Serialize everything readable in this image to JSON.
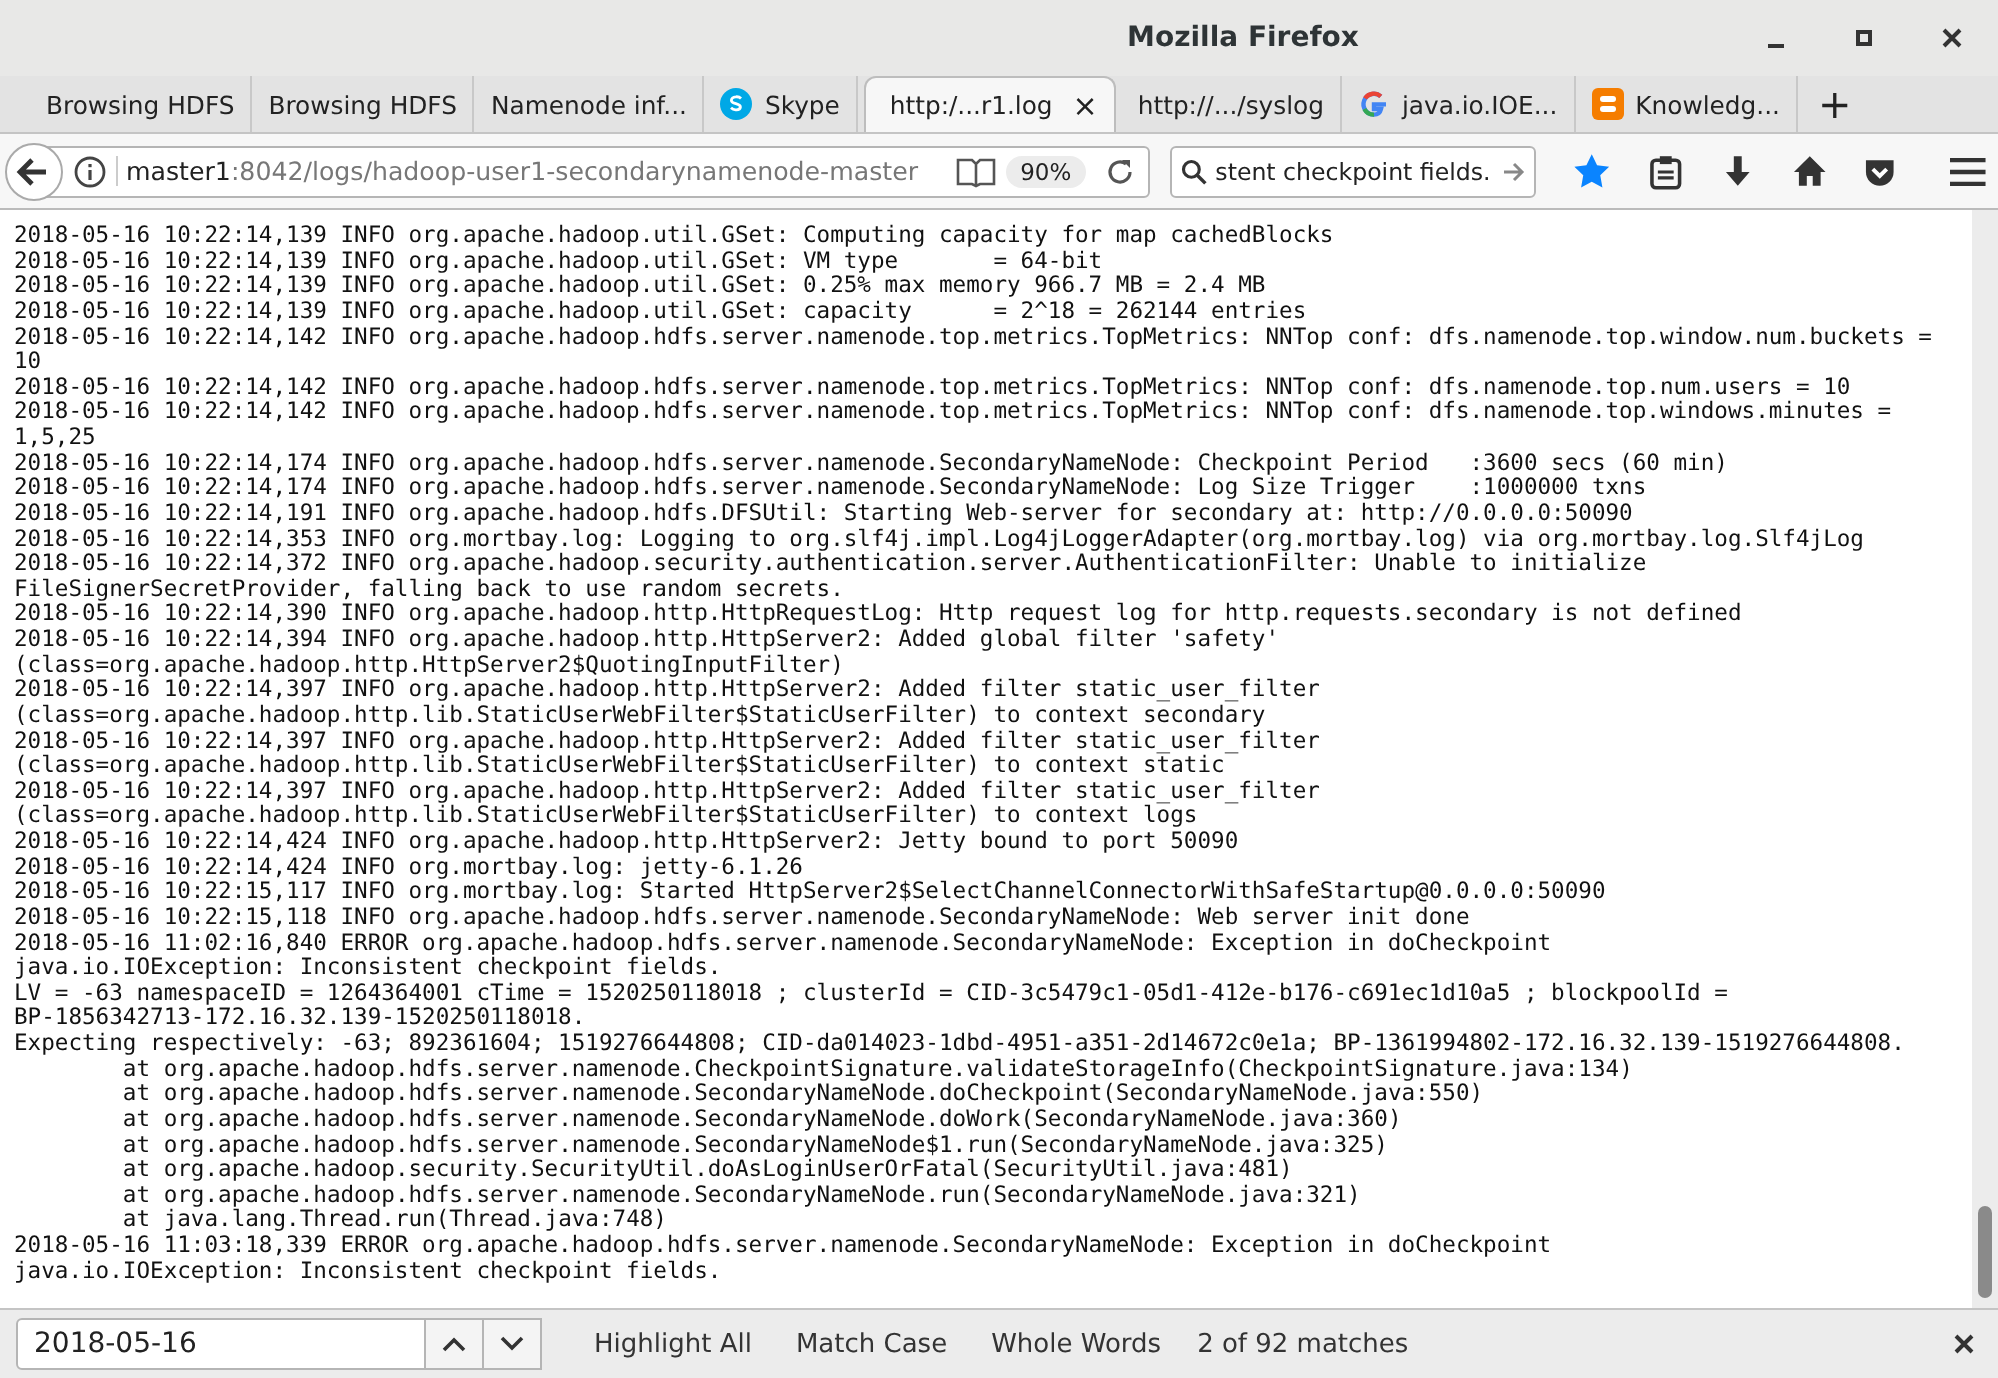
{
  "window": {
    "title": "Mozilla Firefox"
  },
  "tabs": [
    {
      "label": "Browsing HDFS",
      "kind": "plain",
      "selected": false
    },
    {
      "label": "Browsing HDFS",
      "kind": "plain",
      "selected": false
    },
    {
      "label": "Namenode inf...",
      "kind": "plain",
      "selected": false
    },
    {
      "label": "Skype",
      "kind": "skype",
      "selected": false
    },
    {
      "label": "http:/...r1.log",
      "kind": "plain",
      "selected": true,
      "close": "×"
    },
    {
      "label": "http://.../syslog",
      "kind": "plain",
      "selected": false
    },
    {
      "label": "java.io.IOE...",
      "kind": "google",
      "selected": false
    },
    {
      "label": "Knowledg...",
      "kind": "blogger",
      "selected": false
    }
  ],
  "new_tab": "+",
  "address_bar": {
    "host": "master1",
    "path": ":8042/logs/hadoop-user1-secondarynamenode-master",
    "zoom": "90%"
  },
  "search": {
    "value": "stent checkpoint fields."
  },
  "toolbar": {
    "bookmarked": true
  },
  "log_lines": [
    "2018-05-16 10:22:14,139 INFO org.apache.hadoop.util.GSet: Computing capacity for map cachedBlocks",
    "2018-05-16 10:22:14,139 INFO org.apache.hadoop.util.GSet: VM type       = 64-bit",
    "2018-05-16 10:22:14,139 INFO org.apache.hadoop.util.GSet: 0.25% max memory 966.7 MB = 2.4 MB",
    "2018-05-16 10:22:14,139 INFO org.apache.hadoop.util.GSet: capacity      = 2^18 = 262144 entries",
    "2018-05-16 10:22:14,142 INFO org.apache.hadoop.hdfs.server.namenode.top.metrics.TopMetrics: NNTop conf: dfs.namenode.top.window.num.buckets =",
    "10",
    "2018-05-16 10:22:14,142 INFO org.apache.hadoop.hdfs.server.namenode.top.metrics.TopMetrics: NNTop conf: dfs.namenode.top.num.users = 10",
    "2018-05-16 10:22:14,142 INFO org.apache.hadoop.hdfs.server.namenode.top.metrics.TopMetrics: NNTop conf: dfs.namenode.top.windows.minutes =",
    "1,5,25",
    "2018-05-16 10:22:14,174 INFO org.apache.hadoop.hdfs.server.namenode.SecondaryNameNode: Checkpoint Period   :3600 secs (60 min)",
    "2018-05-16 10:22:14,174 INFO org.apache.hadoop.hdfs.server.namenode.SecondaryNameNode: Log Size Trigger    :1000000 txns",
    "2018-05-16 10:22:14,191 INFO org.apache.hadoop.hdfs.DFSUtil: Starting Web-server for secondary at: http://0.0.0.0:50090",
    "2018-05-16 10:22:14,353 INFO org.mortbay.log: Logging to org.slf4j.impl.Log4jLoggerAdapter(org.mortbay.log) via org.mortbay.log.Slf4jLog",
    "2018-05-16 10:22:14,372 INFO org.apache.hadoop.security.authentication.server.AuthenticationFilter: Unable to initialize",
    "FileSignerSecretProvider, falling back to use random secrets.",
    "2018-05-16 10:22:14,390 INFO org.apache.hadoop.http.HttpRequestLog: Http request log for http.requests.secondary is not defined",
    "2018-05-16 10:22:14,394 INFO org.apache.hadoop.http.HttpServer2: Added global filter 'safety'",
    "(class=org.apache.hadoop.http.HttpServer2$QuotingInputFilter)",
    "2018-05-16 10:22:14,397 INFO org.apache.hadoop.http.HttpServer2: Added filter static_user_filter",
    "(class=org.apache.hadoop.http.lib.StaticUserWebFilter$StaticUserFilter) to context secondary",
    "2018-05-16 10:22:14,397 INFO org.apache.hadoop.http.HttpServer2: Added filter static_user_filter",
    "(class=org.apache.hadoop.http.lib.StaticUserWebFilter$StaticUserFilter) to context static",
    "2018-05-16 10:22:14,397 INFO org.apache.hadoop.http.HttpServer2: Added filter static_user_filter",
    "(class=org.apache.hadoop.http.lib.StaticUserWebFilter$StaticUserFilter) to context logs",
    "2018-05-16 10:22:14,424 INFO org.apache.hadoop.http.HttpServer2: Jetty bound to port 50090",
    "2018-05-16 10:22:14,424 INFO org.mortbay.log: jetty-6.1.26",
    "2018-05-16 10:22:15,117 INFO org.mortbay.log: Started HttpServer2$SelectChannelConnectorWithSafeStartup@0.0.0.0:50090",
    "2018-05-16 10:22:15,118 INFO org.apache.hadoop.hdfs.server.namenode.SecondaryNameNode: Web server init done",
    "2018-05-16 11:02:16,840 ERROR org.apache.hadoop.hdfs.server.namenode.SecondaryNameNode: Exception in doCheckpoint",
    "java.io.IOException: Inconsistent checkpoint fields.",
    "LV = -63 namespaceID = 1264364001 cTime = 1520250118018 ; clusterId = CID-3c5479c1-05d1-412e-b176-c691ec1d10a5 ; blockpoolId =",
    "BP-1856342713-172.16.32.139-1520250118018.",
    "Expecting respectively: -63; 892361604; 1519276644808; CID-da014023-1dbd-4951-a351-2d14672c0e1a; BP-1361994802-172.16.32.139-1519276644808.",
    "\tat org.apache.hadoop.hdfs.server.namenode.CheckpointSignature.validateStorageInfo(CheckpointSignature.java:134)",
    "\tat org.apache.hadoop.hdfs.server.namenode.SecondaryNameNode.doCheckpoint(SecondaryNameNode.java:550)",
    "\tat org.apache.hadoop.hdfs.server.namenode.SecondaryNameNode.doWork(SecondaryNameNode.java:360)",
    "\tat org.apache.hadoop.hdfs.server.namenode.SecondaryNameNode$1.run(SecondaryNameNode.java:325)",
    "\tat org.apache.hadoop.security.SecurityUtil.doAsLoginUserOrFatal(SecurityUtil.java:481)",
    "\tat org.apache.hadoop.hdfs.server.namenode.SecondaryNameNode.run(SecondaryNameNode.java:321)",
    "\tat java.lang.Thread.run(Thread.java:748)",
    "2018-05-16 11:03:18,339 ERROR org.apache.hadoop.hdfs.server.namenode.SecondaryNameNode: Exception in doCheckpoint",
    "java.io.IOException: Inconsistent checkpoint fields."
  ],
  "find_bar": {
    "value": "2018-05-16",
    "options": [
      "Highlight All",
      "Match Case",
      "Whole Words"
    ],
    "matches": "2 of 92 matches"
  }
}
